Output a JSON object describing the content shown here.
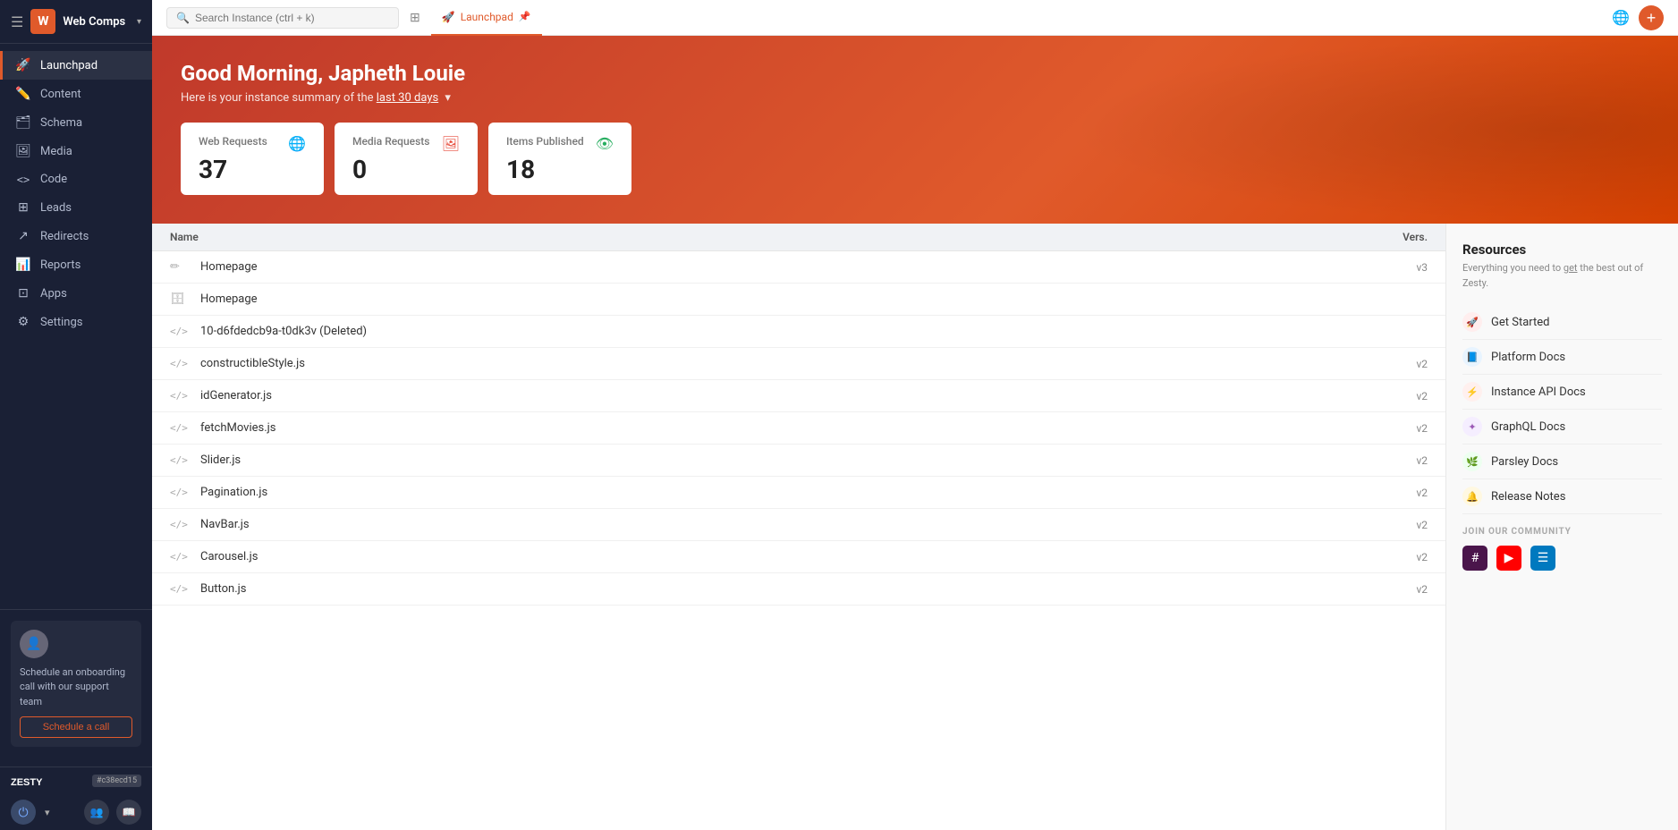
{
  "sidebar": {
    "app_name": "Web Comps",
    "logo_letter": "W",
    "nav_items": [
      {
        "id": "launchpad",
        "label": "Launchpad",
        "icon": "🚀",
        "active": true
      },
      {
        "id": "content",
        "label": "Content",
        "icon": "✏️",
        "active": false
      },
      {
        "id": "schema",
        "label": "Schema",
        "icon": "🗂",
        "active": false
      },
      {
        "id": "media",
        "label": "Media",
        "icon": "🖼",
        "active": false
      },
      {
        "id": "code",
        "label": "Code",
        "icon": "<>",
        "active": false
      },
      {
        "id": "leads",
        "label": "Leads",
        "icon": "⊞",
        "active": false
      },
      {
        "id": "redirects",
        "label": "Redirects",
        "icon": "↗",
        "active": false
      },
      {
        "id": "reports",
        "label": "Reports",
        "icon": "📊",
        "active": false
      },
      {
        "id": "apps",
        "label": "Apps",
        "icon": "⊡",
        "active": false
      },
      {
        "id": "settings",
        "label": "Settings",
        "icon": "⚙",
        "active": false
      }
    ],
    "onboarding_title": "Schedule an onboarding call with our support team",
    "schedule_btn": "Schedule a call",
    "zesty_label": "ZESTY",
    "commit_hash": "#c38ecd15"
  },
  "topbar": {
    "search_placeholder": "Search Instance (ctrl + k)",
    "active_tab": "Launchpad",
    "tabs": [
      {
        "label": "Launchpad",
        "icon": "🚀",
        "active": true
      }
    ]
  },
  "hero": {
    "greeting": "Good Morning, Japheth Louie",
    "subtitle_prefix": "Here is your instance summary of the",
    "period_link": "last 30 days",
    "stats": [
      {
        "id": "web-requests",
        "title": "Web Requests",
        "value": "37",
        "icon_type": "globe",
        "icon_color": "blue"
      },
      {
        "id": "media-requests",
        "title": "Media Requests",
        "value": "0",
        "icon_type": "image",
        "icon_color": "red"
      },
      {
        "id": "items-published",
        "title": "Items Published",
        "value": "18",
        "icon_type": "eye",
        "icon_color": "green"
      }
    ]
  },
  "table": {
    "col_name": "Name",
    "col_version": "Vers.",
    "rows": [
      {
        "name": "Homepage",
        "version": "v3",
        "icon": "edit"
      },
      {
        "name": "Homepage",
        "version": "",
        "icon": "database"
      },
      {
        "name": "10-d6fdedcb9a-t0dk3v (Deleted)",
        "version": "",
        "icon": "code"
      },
      {
        "name": "constructibleStyle.js",
        "version": "v2",
        "icon": "code"
      },
      {
        "name": "idGenerator.js",
        "version": "v2",
        "icon": "code"
      },
      {
        "name": "fetchMovies.js",
        "version": "v2",
        "icon": "code"
      },
      {
        "name": "Slider.js",
        "version": "v2",
        "icon": "code"
      },
      {
        "name": "Pagination.js",
        "version": "v2",
        "icon": "code"
      },
      {
        "name": "NavBar.js",
        "version": "v2",
        "icon": "code"
      },
      {
        "name": "Carousel.js",
        "version": "v2",
        "icon": "code"
      },
      {
        "name": "Button.js",
        "version": "v2",
        "icon": "code"
      }
    ]
  },
  "resources": {
    "title": "Resources",
    "subtitle": "Everything you need to get the best out of Zesty.",
    "links": [
      {
        "id": "get-started",
        "label": "Get Started",
        "color_class": "rl-rocket",
        "symbol": "🚀"
      },
      {
        "id": "platform-docs",
        "label": "Platform Docs",
        "color_class": "rl-book",
        "symbol": "📘"
      },
      {
        "id": "instance-api",
        "label": "Instance API Docs",
        "color_class": "rl-api",
        "symbol": "⚡"
      },
      {
        "id": "graphql-docs",
        "label": "GraphQL Docs",
        "color_class": "rl-graphql",
        "symbol": "✦"
      },
      {
        "id": "parsley-docs",
        "label": "Parsley Docs",
        "color_class": "rl-parsley",
        "symbol": "🌿"
      },
      {
        "id": "release-notes",
        "label": "Release Notes",
        "color_class": "rl-notes",
        "symbol": "🔔"
      }
    ],
    "community_label": "JOIN OUR COMMUNITY",
    "community_icons": [
      {
        "id": "slack",
        "symbol": "#",
        "class": "ci-slack"
      },
      {
        "id": "youtube",
        "symbol": "▶",
        "class": "ci-youtube"
      },
      {
        "id": "trello",
        "symbol": "☰",
        "class": "ci-table"
      }
    ]
  }
}
